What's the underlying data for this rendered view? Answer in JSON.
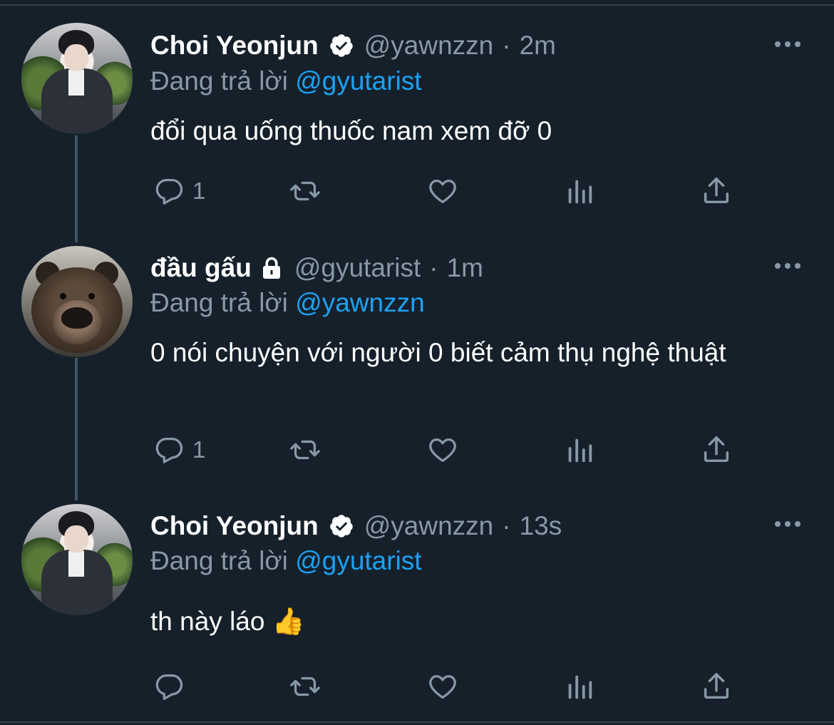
{
  "tweets": [
    {
      "author": {
        "name": "Choi Yeonjun",
        "handle": "@yawnzzn",
        "verified": true,
        "protected": false,
        "avatar": "person-photo"
      },
      "time": "2m",
      "replying_label": "Đang trả lời",
      "replying_to": "@gyutarist",
      "text": "đổi qua uống thuốc nam xem đỡ 0",
      "reply_count": "1"
    },
    {
      "author": {
        "name": "đầu gấu",
        "handle": "@gyutarist",
        "verified": false,
        "protected": true,
        "avatar": "bear-photo"
      },
      "time": "1m",
      "replying_label": "Đang trả lời",
      "replying_to": "@yawnzzn",
      "text": "0 nói chuyện với người 0 biết cảm thụ nghệ thuật",
      "reply_count": "1"
    },
    {
      "author": {
        "name": "Choi Yeonjun",
        "handle": "@yawnzzn",
        "verified": true,
        "protected": false,
        "avatar": "person-photo"
      },
      "time": "13s",
      "replying_label": "Đang trả lời",
      "replying_to": "@gyutarist",
      "text": "th này láo 👍",
      "reply_count": ""
    }
  ],
  "separator": "·",
  "icons": {
    "reply": "reply-icon",
    "retweet": "retweet-icon",
    "like": "heart-icon",
    "analytics": "analytics-icon",
    "share": "share-icon",
    "more": "more-icon",
    "verified": "verified-badge-icon",
    "protected": "lock-icon"
  },
  "colors": {
    "background": "#15202b",
    "text": "#ffffff",
    "muted": "#8899a6",
    "link": "#1da1f2",
    "thread_line": "#3d5466"
  }
}
